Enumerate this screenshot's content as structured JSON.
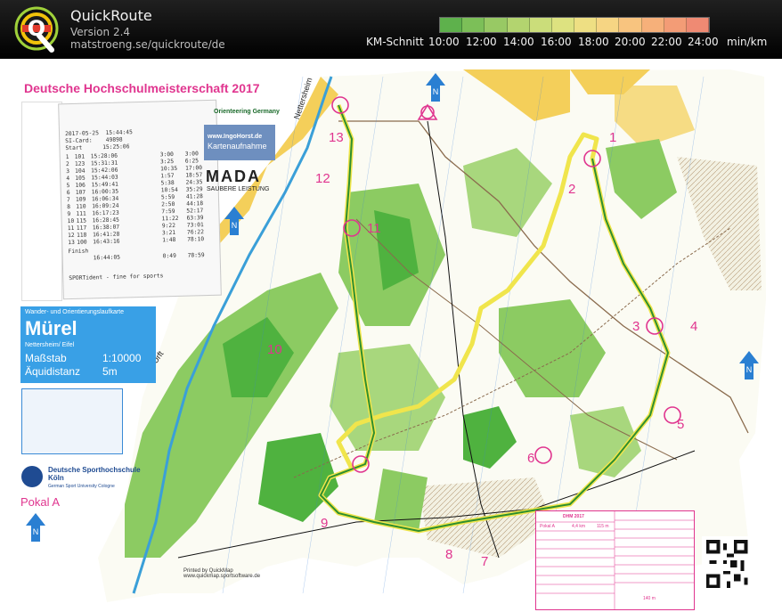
{
  "app": {
    "title": "QuickRoute",
    "version": "Version 2.4",
    "url": "matstroeng.se/quickroute/de"
  },
  "speed_legend": {
    "label": "KM-Schnitt",
    "ticks": [
      "10:00",
      "12:00",
      "14:00",
      "16:00",
      "18:00",
      "20:00",
      "22:00",
      "24:00"
    ],
    "unit": "min/km",
    "colors": [
      "#5eb14c",
      "#7cbf58",
      "#98c964",
      "#b3d46f",
      "#cbdd7a",
      "#dde280",
      "#eedf83",
      "#f6d583",
      "#f8c47f",
      "#f6b07a",
      "#f39c76",
      "#ef8a73"
    ]
  },
  "map": {
    "event_title": "Deutsche Hochschulmeisterschaft 2017",
    "brand": {
      "orienteering_germany": "Orienteering Germany",
      "ingohorst": "www.IngoHorst.de",
      "kartenaufnahme": "Kartenaufnahme",
      "mada": "MADA",
      "saubere": "SAUBERE LEISTUNG"
    },
    "place": "Nettersheim",
    "river": "Urft",
    "scale_box": {
      "subtitle": "Wander- und Orientierungslaufkarte",
      "name": "Mürel",
      "location": "Nettersheim/ Eifel",
      "scale_label": "Maßstab",
      "scale_value": "1:10000",
      "contour_label": "Äquidistanz",
      "contour_value": "5m"
    },
    "university": {
      "name": "Deutsche Sporthochschule Köln",
      "english": "German Sport University Cologne"
    },
    "course": "Pokal A",
    "printed_by": "Printed by QuickMap",
    "printed_url": "www.quickmap.sportsoftware.de",
    "control_numbers": [
      "1",
      "2",
      "3",
      "4",
      "5",
      "6",
      "7",
      "8",
      "9",
      "10",
      "11",
      "12",
      "13"
    ],
    "north_label": "N"
  },
  "splits": {
    "header_date": "2017-05-25  15:44:45",
    "si_card": "SI-Card:    49898",
    "start": "Start      15:25:06",
    "rows": [
      {
        "n": "1",
        "code": "101",
        "time": "15:28:06",
        "leg": "3:00",
        "total": "3:00"
      },
      {
        "n": "2",
        "code": "123",
        "time": "15:31:31",
        "leg": "3:25",
        "total": "6:25"
      },
      {
        "n": "3",
        "code": "104",
        "time": "15:42:06",
        "leg": "10:35",
        "total": "17:00"
      },
      {
        "n": "4",
        "code": "105",
        "time": "15:44:03",
        "leg": "1:57",
        "total": "18:57"
      },
      {
        "n": "5",
        "code": "106",
        "time": "15:49:41",
        "leg": "5:38",
        "total": "24:35"
      },
      {
        "n": "6",
        "code": "107",
        "time": "16:00:35",
        "leg": "10:54",
        "total": "35:29"
      },
      {
        "n": "7",
        "code": "109",
        "time": "16:06:34",
        "leg": "5:59",
        "total": "41:28"
      },
      {
        "n": "8",
        "code": "110",
        "time": "16:09:24",
        "leg": "2:50",
        "total": "44:18"
      },
      {
        "n": "9",
        "code": "111",
        "time": "16:17:23",
        "leg": "7:59",
        "total": "52:17"
      },
      {
        "n": "10",
        "code": "115",
        "time": "16:28:45",
        "leg": "11:22",
        "total": "63:39"
      },
      {
        "n": "11",
        "code": "117",
        "time": "16:38:07",
        "leg": "9:22",
        "total": "73:01"
      },
      {
        "n": "12",
        "code": "118",
        "time": "16:41:28",
        "leg": "3:21",
        "total": "76:22"
      },
      {
        "n": "13",
        "code": "100",
        "time": "16:43:16",
        "leg": "1:48",
        "total": "78:10"
      }
    ],
    "finish_label": "Finish",
    "finish_time": "16:44:05",
    "finish_leg": "0:49",
    "finish_total": "78:59",
    "footer": "SPORTident - fine for sports"
  },
  "description": {
    "title": "DHM 2017",
    "course": "Pokal A",
    "length": "4,4 km",
    "climb": "115 m",
    "finish_dist": "140 m"
  }
}
